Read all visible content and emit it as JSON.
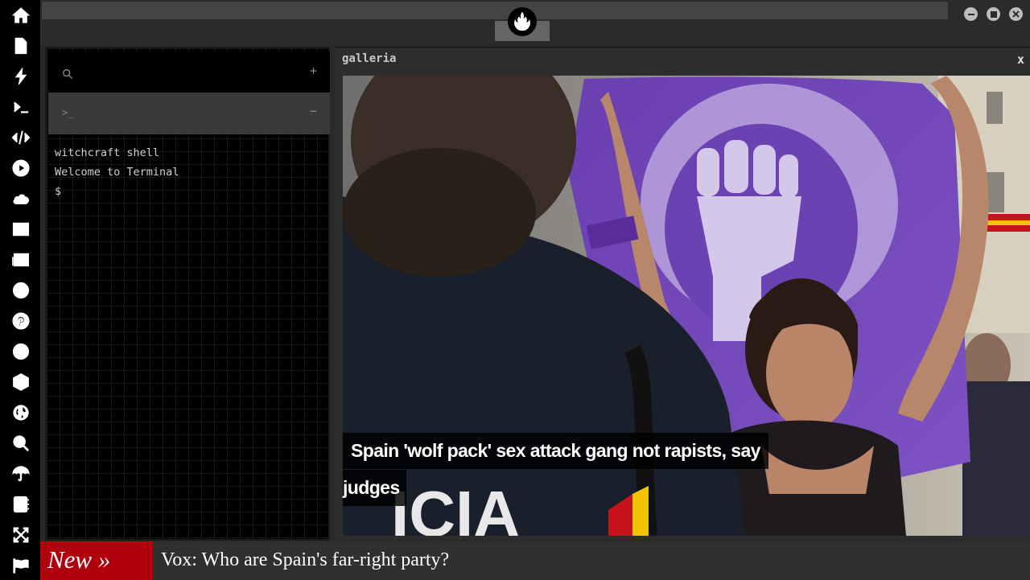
{
  "sidebar": {
    "icons": [
      "home-icon",
      "document-icon",
      "bolt-icon",
      "terminal-icon",
      "code-icon",
      "play-icon",
      "cloud-icon",
      "image-icon",
      "newspaper-icon",
      "wordpress-icon",
      "pinterest-icon",
      "galactic-empire-icon",
      "hexagon-network-icon",
      "globe-icon",
      "search-icon",
      "umbrella-icon",
      "address-book-icon",
      "expand-icon",
      "flag-icon"
    ]
  },
  "topbar": {
    "logo_icon": "rebel-alliance-icon"
  },
  "terminal": {
    "plus_label": "+",
    "prompt_label": ">_",
    "minus_label": "−",
    "lines": [
      "witchcraft shell",
      "Welcome to Terminal",
      "$"
    ]
  },
  "gallery": {
    "title": "galleria",
    "close_label": "x",
    "caption_line1": "Spain 'wolf pack' sex attack gang not rapists, say",
    "caption_line2": "judges"
  },
  "ticker": {
    "badge": "New »",
    "headline": "Vox: Who are Spain's far-right party?"
  },
  "colors": {
    "sidebar_bg": "#000000",
    "ticker_badge": "#b0000d",
    "app_bg": "#2a2a2a"
  }
}
